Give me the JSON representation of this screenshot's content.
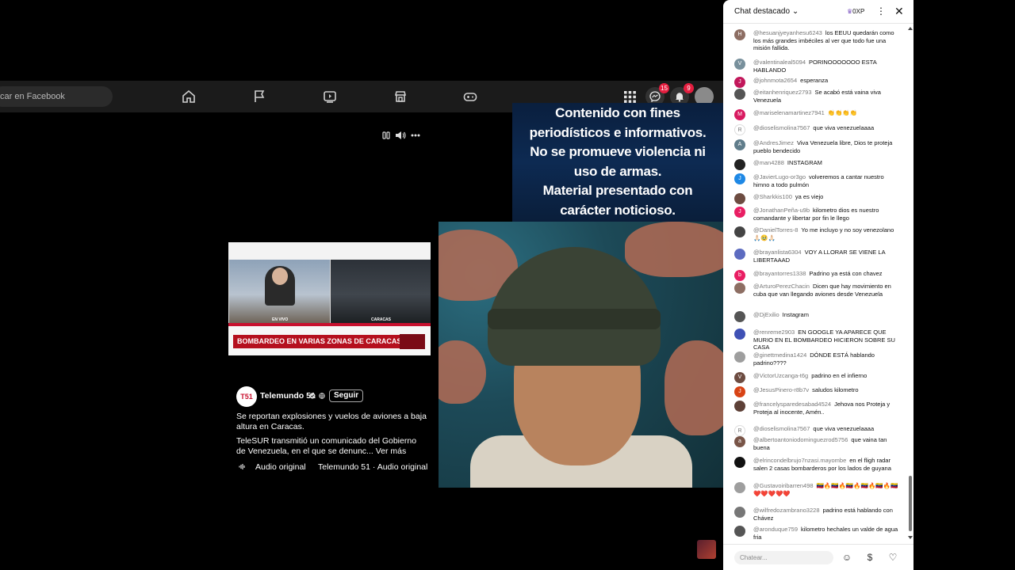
{
  "facebook": {
    "search_placeholder": "car en Facebook",
    "badges": {
      "messenger": "15",
      "notifications": "9"
    }
  },
  "notice": {
    "lines": [
      "Contenido con fines",
      "periodísticos e informativos.",
      "No se promueve violencia ni",
      "uso de armas.",
      "Material presentado con",
      "carácter noticioso."
    ]
  },
  "news": {
    "tag_left": "EN VIVO",
    "tag_right": "CARACAS",
    "headline": "BOMBARDEO EN VARIAS ZONAS DE CARACAS",
    "logo_text": "T51"
  },
  "post": {
    "page_name": "Telemundo 51",
    "follow": "Seguir",
    "description": "Se reportan explosiones y vuelos de aviones a baja altura en Caracas.",
    "description2": "TeleSUR transmitió un comunicado del Gobierno de Venezuela, en el que se denunc... Ver más",
    "audio_original": "Audio original",
    "audio_source": "Telemundo 51 · Audio original"
  },
  "chat": {
    "title": "Chat destacado",
    "xp": "0XP",
    "input_placeholder": "Chatear...",
    "messages": [
      {
        "author": "@hesuanjyeyanhesu6243",
        "text": "los EEUU quedarán como los más grandes imbéciles al ver que todo fue una misión fallida.",
        "initial": "H",
        "color": "#8d6e63"
      },
      {
        "author": "@valentinaleal5094",
        "text": "PORINOOOOOOO ESTA HABLANDO",
        "initial": "V",
        "color": "#78909c"
      },
      {
        "author": "@johnmota2654",
        "text": "esperanza",
        "initial": "J",
        "color": "#c2185b"
      },
      {
        "author": "@eitanhenriquez2793",
        "text": "Se acabó está vaina viva Venezuela",
        "initial": "",
        "color": "#555555"
      },
      {
        "author": "@mariselenamartinez7941",
        "text": "👏👏👏👏",
        "initial": "M",
        "color": "#d81b60"
      },
      {
        "author": "@dioselismolina7567",
        "text": "que viva venezuelaaaa",
        "initial": "R",
        "color": "#ffffff"
      },
      {
        "author": "@AndresJimez",
        "text": "Viva Venezuela libre, Dios te proteja pueblo bendecido",
        "initial": "A",
        "color": "#607d8b"
      },
      {
        "author": "@man4288",
        "text": "INSTAGRAM",
        "initial": "",
        "color": "#222222"
      },
      {
        "author": "@JavierLugo-or3go",
        "text": "volveremos a cantar nuestro himno a todo pulmón",
        "initial": "J",
        "color": "#1e88e5"
      },
      {
        "author": "@Sharkkis100",
        "text": "ya es viejo",
        "initial": "",
        "color": "#6d4c41"
      },
      {
        "author": "@JonathanPeña-u9b",
        "text": "kilometro dios es nuestro comandante y libertar por fin le llego",
        "initial": "J",
        "color": "#e91e63"
      },
      {
        "author": "@DanielTorres-8",
        "text": "Yo me incluyo y no soy venezolano 🙏🏻🥹🙏🏻",
        "initial": "",
        "color": "#444444"
      },
      {
        "author": "@brayanlista6304",
        "text": "VOY A LLORAR SE VIENE LA LIBERTAAAD",
        "initial": "",
        "color": "#5c6bc0"
      },
      {
        "author": "@brayantorres1338",
        "text": "Padrino ya está con chavez",
        "initial": "b",
        "color": "#e91e63"
      },
      {
        "author": "@ArturoPerezChacin",
        "text": "Dicen que hay movimiento en cuba que van llegando aviones desde Venezuela",
        "initial": "",
        "color": "#8d6e63"
      },
      {
        "author": "@DjExilio",
        "text": "Instagram",
        "initial": "",
        "color": "#555555"
      },
      {
        "author": "@renreme2903",
        "text": "EN GOOGLE YA APARECE QUE MURIO EN EL BOMBARDEO HICIERON SOBRE SU CASA",
        "initial": "",
        "color": "#3f51b5"
      },
      {
        "author": "@ginettmedina1424",
        "text": "DÓNDE ESTÁ hablando padrino????",
        "initial": "",
        "color": "#9e9e9e"
      },
      {
        "author": "@VictorUzcanga-t6g",
        "text": "padrino en el infierno",
        "initial": "V",
        "color": "#6d4c41"
      },
      {
        "author": "@JesusPinero-r8b7v",
        "text": "saludos kilometro",
        "initial": "J",
        "color": "#d84315"
      },
      {
        "author": "@francelysparedesabad4524",
        "text": "Jehova nos Proteja y Proteja al inocente, Amén..",
        "initial": "",
        "color": "#5d4037"
      },
      {
        "author": "@dioselismolina7567",
        "text": "que viva venezuelaaaa",
        "initial": "R",
        "color": "#ffffff"
      },
      {
        "author": "@albertoantoniodominguezrod5756",
        "text": "que vaina tan buena",
        "initial": "a",
        "color": "#795548"
      },
      {
        "author": "@elrincondelbrujo7nzasi.mayombe",
        "text": "en el fligh radar salen 2 casas bombarderos por los lados de guyana",
        "initial": "",
        "color": "#111111"
      },
      {
        "author": "@Gustavoiribarren498",
        "text": "🇻🇪🔥🇻🇪🔥🇻🇪🔥🇻🇪🔥🇻🇪🔥🇻🇪❤️❤️❤️❤️❤️",
        "initial": "",
        "color": "#9e9e9e"
      },
      {
        "author": "@wilfredozambrano3228",
        "text": "padrino está hablando con Chávez",
        "initial": "",
        "color": "#777777"
      },
      {
        "author": "@aronduque759",
        "text": "kilometro hechales un valde de agua fria",
        "initial": "",
        "color": "#555555"
      }
    ]
  }
}
